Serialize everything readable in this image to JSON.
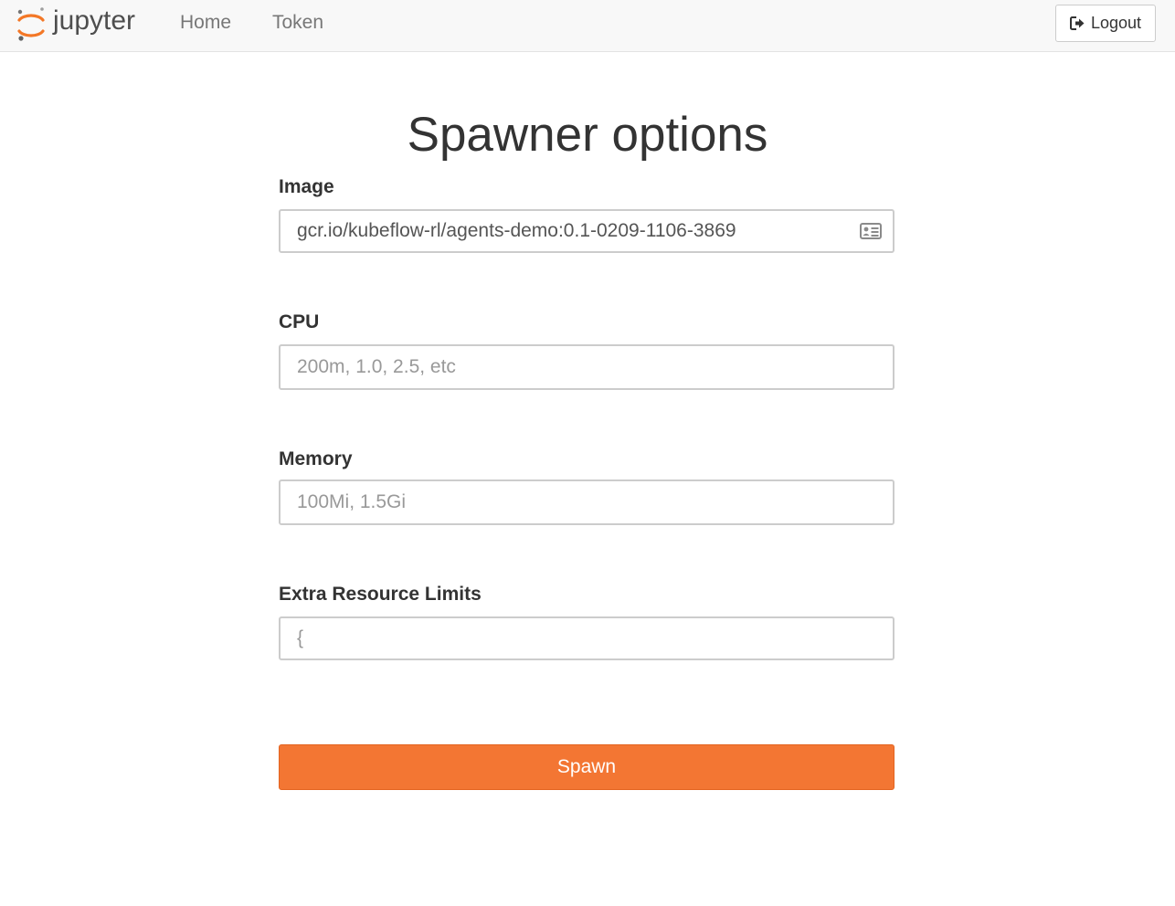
{
  "navbar": {
    "logo_text": "jupyter",
    "links": [
      {
        "label": "Home"
      },
      {
        "label": "Token"
      }
    ],
    "logout_label": "Logout"
  },
  "page": {
    "title": "Spawner options"
  },
  "form": {
    "image": {
      "label": "Image",
      "value": "gcr.io/kubeflow-rl/agents-demo:0.1-0209-1106-3869",
      "icon": "contact-card-icon"
    },
    "cpu": {
      "label": "CPU",
      "placeholder": "200m, 1.0, 2.5, etc"
    },
    "memory": {
      "label": "Memory",
      "placeholder": "100Mi, 1.5Gi"
    },
    "extra_resource_limits": {
      "label": "Extra Resource Limits",
      "placeholder": "{"
    },
    "submit_label": "Spawn"
  },
  "colors": {
    "accent": "#f37633",
    "navbar_bg": "#f8f8f8"
  }
}
